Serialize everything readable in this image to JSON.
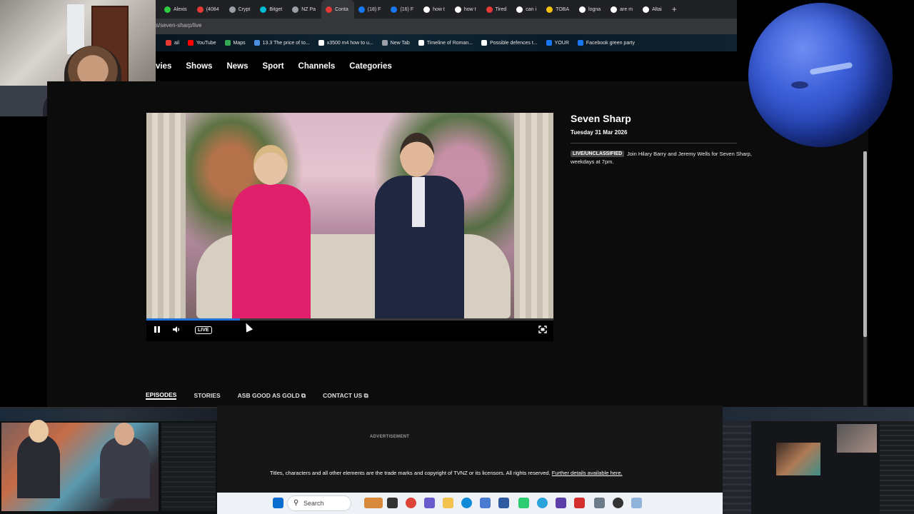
{
  "browser": {
    "tabs": [
      {
        "label": "Alexis",
        "color": "#2ecc40"
      },
      {
        "label": "(4084",
        "color": "#e53935"
      },
      {
        "label": "Crypt",
        "color": "#9aa0a6"
      },
      {
        "label": "Bitget",
        "color": "#00bcd4"
      },
      {
        "label": "NZ Pa",
        "color": "#9aa0a6"
      },
      {
        "label": "Conta",
        "color": "#e53935",
        "active": true
      },
      {
        "label": "(18) F",
        "color": "#1877f2"
      },
      {
        "label": "(16) F",
        "color": "#1877f2"
      },
      {
        "label": "how t",
        "color": "#ffffff"
      },
      {
        "label": "how t",
        "color": "#ffffff"
      },
      {
        "label": "Tired",
        "color": "#e53935"
      },
      {
        "label": "can i",
        "color": "#ffffff"
      },
      {
        "label": "TOBA",
        "color": "#f4c20d"
      },
      {
        "label": "logna",
        "color": "#ffffff"
      },
      {
        "label": "are m",
        "color": "#ffffff"
      },
      {
        "label": "Altai",
        "color": "#ffffff"
      }
    ],
    "new_tab_symbol": "+",
    "url_fragment": "s/seven-sharp/live",
    "bookmarks": [
      {
        "label": "ail",
        "color": "#e53935"
      },
      {
        "label": "YouTube",
        "color": "#ff0000"
      },
      {
        "label": "Maps",
        "color": "#34a853"
      },
      {
        "label": "13.3 The price of to...",
        "color": "#4a90e2"
      },
      {
        "label": "x3500 m4 how to u...",
        "color": "#ffffff"
      },
      {
        "label": "New Tab",
        "color": "#9aa0a6"
      },
      {
        "label": "Timeline of Roman...",
        "color": "#ffffff"
      },
      {
        "label": "Possible defences t...",
        "color": "#ffffff"
      },
      {
        "label": "YOUR",
        "color": "#1877f2"
      },
      {
        "label": "Facebook green party",
        "color": "#1877f2"
      }
    ]
  },
  "nav": {
    "items": [
      "vies",
      "Shows",
      "News",
      "Sport",
      "Channels",
      "Categories"
    ]
  },
  "player": {
    "pause_icon": "pause-icon",
    "volume_icon": "volume-icon",
    "live_label": "LIVE",
    "fullscreen_icon": "fullscreen-icon",
    "progress": 0.23,
    "accent": "#1e73d8"
  },
  "show": {
    "title": "Seven Sharp",
    "date": "Tuesday 31 Mar 2026",
    "badge": "LIVE/UNCLASSIFIED",
    "description": "Join Hilary Barry and Jeremy Wells for Seven Sharp, weekdays at 7pm."
  },
  "tabs": {
    "episodes": "EPISODES",
    "stories": "STORIES",
    "asb": "ASB GOOD AS GOLD ⧉",
    "contact": "CONTACT US ⧉"
  },
  "footer": {
    "advertisement": "ADVERTISEMENT",
    "copyright": "Titles, characters and all other elements are the trade marks and copyright of TVNZ or its licensors. All rights reserved.",
    "link": "Further details available here."
  },
  "taskbar": {
    "search_label": "Search"
  }
}
